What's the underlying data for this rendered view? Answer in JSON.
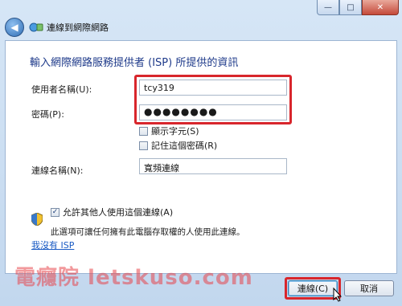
{
  "window": {
    "title": "連線到網際網路",
    "controls": {
      "minimize": "—",
      "maximize": "□",
      "close": "✕"
    }
  },
  "heading": "輸入網際網路服務提供者 (ISP) 所提供的資訊",
  "form": {
    "username_label": "使用者名稱(U):",
    "username_value": "tcy319",
    "password_label": "密碼(P):",
    "password_value": "●●●●●●●●",
    "show_chars_label": "顯示字元(S)",
    "remember_password_label": "記住這個密碼(R)",
    "connection_name_label": "連線名稱(N):",
    "connection_name_value": "寬頻連線",
    "allow_others_label": "允許其他人使用這個連線(A)",
    "allow_others_note": "此選項可讓任何擁有此電腦存取權的人使用此連線。",
    "no_isp_link": "我沒有 ISP"
  },
  "watermark": "電癮院 letskuso.com",
  "buttons": {
    "connect": "連線(C)",
    "cancel": "取消"
  },
  "colors": {
    "highlight": "#d8262c",
    "heading": "#1e3a8a",
    "link": "#1a5bc4"
  },
  "checkbox_states": {
    "show_chars": false,
    "remember_password": false,
    "allow_others": true
  }
}
